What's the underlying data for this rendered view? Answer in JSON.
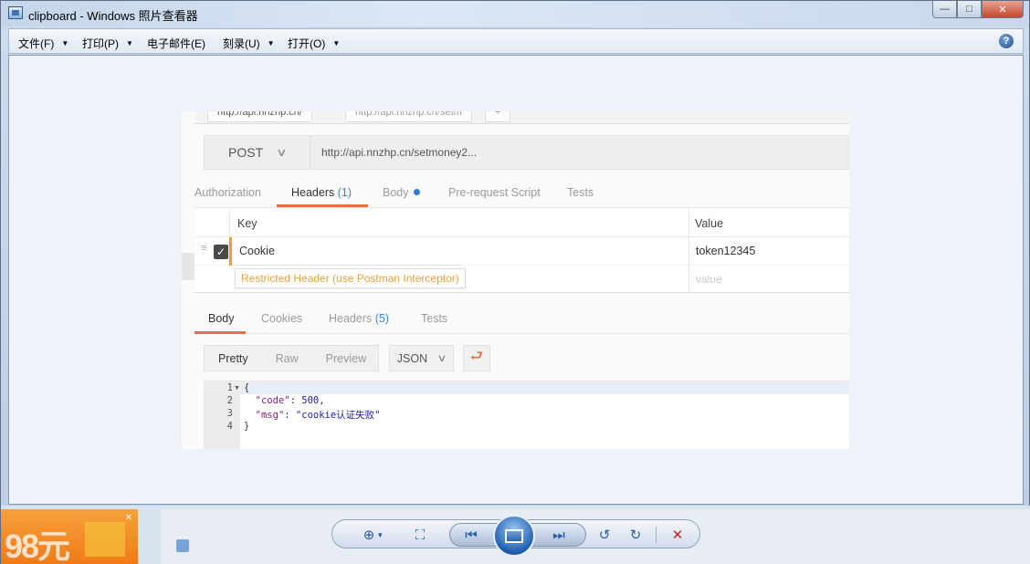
{
  "window": {
    "title": "clipboard - Windows 照片查看器",
    "buttons": {
      "minimize": "—",
      "maximize": "□",
      "close": "✕"
    }
  },
  "menubar": {
    "items": [
      {
        "label": "文件(F)",
        "has_caret": true
      },
      {
        "label": "打印(P)",
        "has_caret": true
      },
      {
        "label": "电子邮件(E)",
        "has_caret": false
      },
      {
        "label": "刻录(U)",
        "has_caret": true
      },
      {
        "label": "打开(O)",
        "has_caret": true
      }
    ],
    "help": "?"
  },
  "postman": {
    "tabs": [
      "http://api.nnzhp.cn/",
      "http://api.nnzhp.cn/setm",
      "+"
    ],
    "request": {
      "method": "POST",
      "url": "http://api.nnzhp.cn/setmoney2..."
    },
    "request_tabs": {
      "authorization": "Authorization",
      "headers": "Headers",
      "headers_count": "(1)",
      "body": "Body",
      "pre_request": "Pre-request Script",
      "tests": "Tests"
    },
    "headers_table": {
      "col_key": "Key",
      "col_value": "Value",
      "rows": [
        {
          "key": "Cookie",
          "value": "token12345",
          "checked": true
        }
      ],
      "value_placeholder": "value",
      "warning": "Restricted Header (use Postman Interceptor)"
    },
    "response_tabs": {
      "body": "Body",
      "cookies": "Cookies",
      "headers": "Headers",
      "headers_count": "(5)",
      "tests": "Tests"
    },
    "response_toolbar": {
      "views": [
        "Pretty",
        "Raw",
        "Preview"
      ],
      "active_view": "Pretty",
      "format": "JSON"
    },
    "response_body": {
      "line_numbers": [
        "1",
        "2",
        "3",
        "4"
      ],
      "open_brace": "{",
      "close_brace": "}",
      "code_key": "\"code\"",
      "code_value": "500",
      "msg_key": "\"msg\"",
      "msg_value": "\"cookie认证失败\""
    }
  },
  "background": {
    "ad_text": "98元"
  },
  "colors": {
    "accent_orange": "#f26b3a",
    "warning_amber": "#e8a03a",
    "link_blue": "#3a86d4",
    "viewer_bg": "#eef3fa"
  }
}
